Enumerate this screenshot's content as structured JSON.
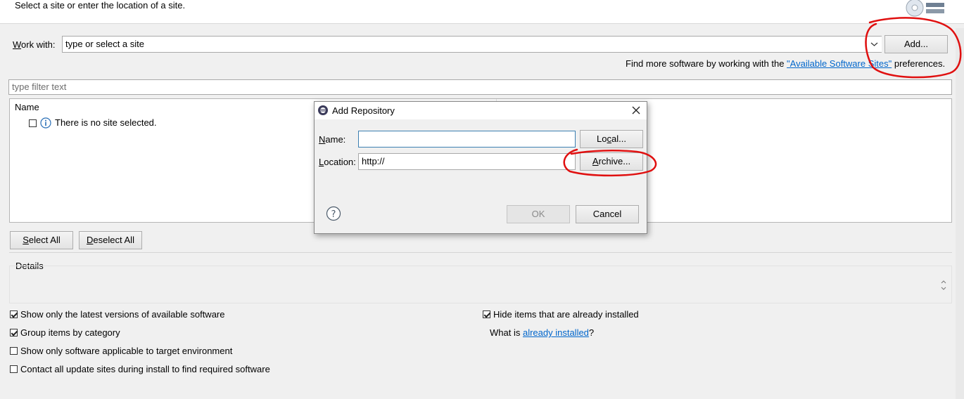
{
  "header": {
    "instruction": "Select a site or enter the location of a site."
  },
  "work_with": {
    "label_prefix": "W",
    "label_rest": "ork with:",
    "combo_value": "type or select a site",
    "add_button": "Add...",
    "find_more_prefix": "Find more software by working with the ",
    "find_more_link": "\"Available Software Sites\"",
    "find_more_suffix": " preferences."
  },
  "filter": {
    "placeholder": "type filter text"
  },
  "tree": {
    "column_name": "Name",
    "empty_message": "There is no site selected."
  },
  "buttons": {
    "select_all": "Select All",
    "deselect_all": "Deselect All"
  },
  "details": {
    "label": "Details"
  },
  "options": [
    {
      "label": "Show only the latest versions of available software",
      "checked": true
    },
    {
      "label": "Group items by category",
      "checked": true
    },
    {
      "label": "Show only software applicable to target environment",
      "checked": false
    },
    {
      "label": "Contact all update sites during install to find required software",
      "checked": false
    },
    {
      "label": "Hide items that are already installed",
      "checked": true
    }
  ],
  "installed": {
    "prefix": "What is ",
    "link": "already installed",
    "suffix": "?"
  },
  "dialog": {
    "title": "Add Repository",
    "name_label": "Name:",
    "name_value": "",
    "local_button": "Local...",
    "location_label": "Location:",
    "location_value": "http://",
    "archive_button": "Archive...",
    "ok_button": "OK",
    "cancel_button": "Cancel",
    "ok_enabled": false
  },
  "colors": {
    "link": "#0066cc",
    "focus_border": "#3c7fb1",
    "annotation": "#e01010"
  }
}
